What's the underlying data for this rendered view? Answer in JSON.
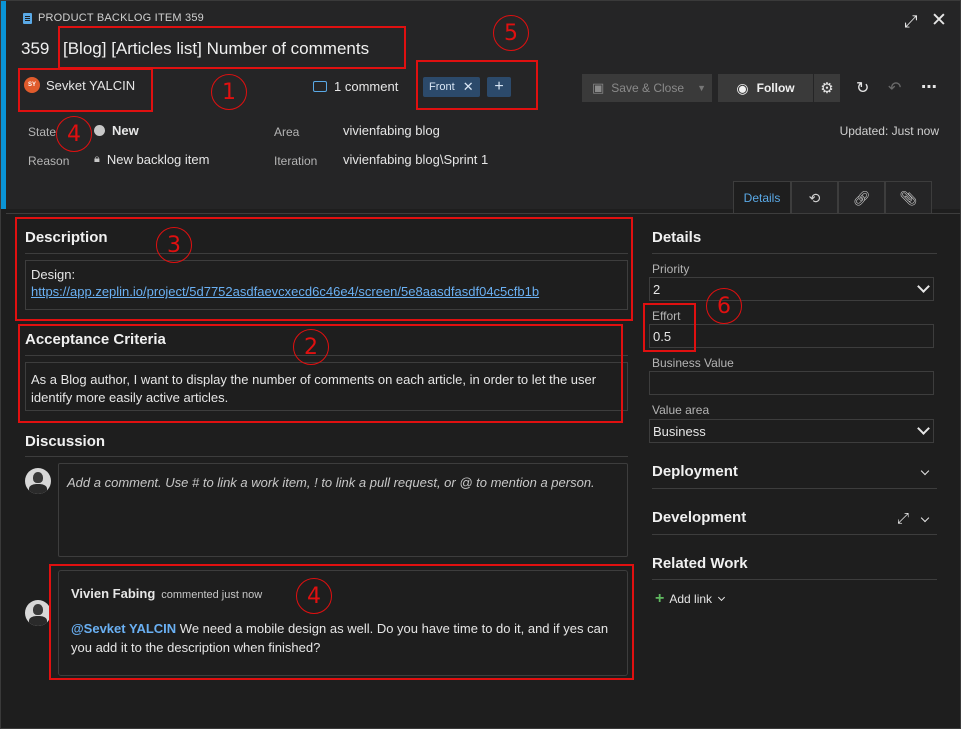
{
  "header": {
    "item_type": "PRODUCT BACKLOG ITEM 359",
    "id": "359",
    "title": "[Blog] [Articles list] Number of comments",
    "assignee_initials": "SY",
    "assignee": "Sevket YALCIN",
    "comment_count": "1 comment",
    "tags": [
      "Front"
    ],
    "save_close": "Save & Close",
    "follow": "Follow",
    "updated": "Updated: Just now"
  },
  "fields": {
    "state_label": "State",
    "state_value": "New",
    "reason_label": "Reason",
    "reason_value": "New backlog item",
    "area_label": "Area",
    "area_value": "vivienfabing blog",
    "iteration_label": "Iteration",
    "iteration_value": "vivienfabing blog\\Sprint 1"
  },
  "tabs": {
    "details": "Details"
  },
  "description": {
    "title": "Description",
    "text": "Design:",
    "link": "https://app.zeplin.io/project/5d7752asdfaevcxecd6c46e4/screen/5e8aasdfasdf04c5cfb1b"
  },
  "acceptance": {
    "title": "Acceptance Criteria",
    "text": "As a Blog author, I want to display the number of comments on each article, in order to let the user identify more easily active articles."
  },
  "discussion": {
    "title": "Discussion",
    "placeholder": "Add a comment. Use # to link a work item, ! to link a pull request, or @ to mention a person.",
    "comment_author": "Vivien Fabing",
    "comment_meta": "commented just now",
    "comment_mention": "@Sevket YALCIN",
    "comment_text": " We need a mobile design as well. Do you have time to do it, and if yes can you add it to the description when finished?"
  },
  "details": {
    "title": "Details",
    "priority_label": "Priority",
    "priority_value": "2",
    "effort_label": "Effort",
    "effort_value": "0.5",
    "business_value_label": "Business Value",
    "business_value": "",
    "value_area_label": "Value area",
    "value_area_value": "Business",
    "deployment": "Deployment",
    "development": "Development",
    "related_work": "Related Work",
    "add_link": "Add link"
  },
  "annotations": [
    "1",
    "2",
    "3",
    "4",
    "4",
    "5",
    "6"
  ],
  "colors": {
    "accent": "#0a94d6",
    "annotation": "#e01010",
    "tag_bg": "#2c4a6b",
    "link": "#6ab0f3"
  }
}
